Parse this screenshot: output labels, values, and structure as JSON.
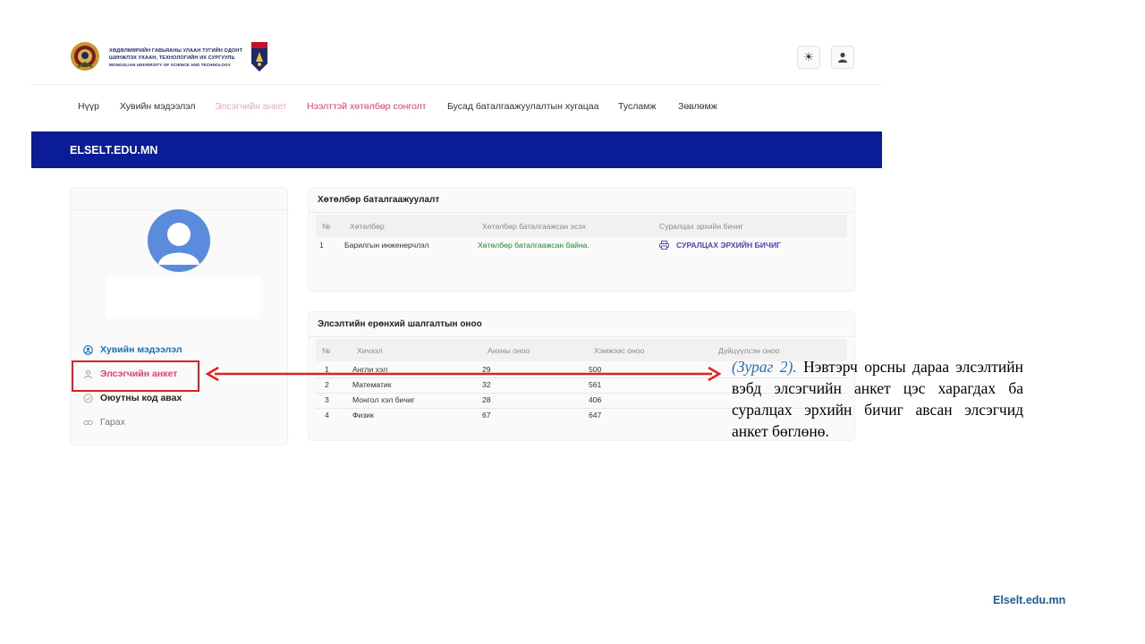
{
  "header": {
    "logo_text": [
      "ХӨДӨЛМӨРИЙН ГАВЬЯАНЫ УЛААН ТУГИЙН ОДОНТ",
      "ШИНЖЛЭХ УХААН, ТЕХНОЛОГИЙН ИХ СУРГУУЛЬ",
      "MONGOLIAN UNIVERSITY OF SCIENCE AND TECHNOLOGY"
    ],
    "theme_icon": "sun-icon",
    "profile_icon": "user-icon"
  },
  "nav": {
    "items": [
      {
        "label": "Нүүр"
      },
      {
        "label": "Хувийн мэдээлэл"
      },
      {
        "label": "Элсэгчийн анкет"
      },
      {
        "label": "Нээлттэй хөтөлбөр сонголт"
      },
      {
        "label": "Бусад баталгаажуулалтын хугацаа"
      },
      {
        "label": "Тусламж"
      },
      {
        "label": "Зөвлөмж"
      }
    ]
  },
  "banner": {
    "title": "ELSELT.EDU.MN"
  },
  "sidebar": {
    "items": [
      {
        "label": "Хувийн мэдээлэл",
        "icon": "user-circle-icon"
      },
      {
        "label": "Элсэгчийн анкет",
        "icon": "user-icon"
      },
      {
        "label": "Оюутны код авах",
        "icon": "check-circle-icon"
      },
      {
        "label": "Гарах",
        "icon": "link-icon"
      }
    ]
  },
  "program_card": {
    "title": "Хөтөлбөр баталгаажуулалт",
    "columns": [
      "№",
      "Хөтөлбөр",
      "Хөтөлбөр баталгаажсан эсэх",
      "Суралцах эрхийн бичиг"
    ],
    "rows": [
      {
        "no": "1",
        "program": "Барилгын инженерчлэл",
        "status": "Хөтөлбөр баталгаажсан байна.",
        "certificate": "СУРАЛЦАХ ЭРХИЙН БИЧИГ"
      }
    ]
  },
  "score_card": {
    "title": "Элсэлтийн ерөнхий шалгалтын оноо",
    "columns": [
      "№",
      "Хичээл",
      "Анхны оноо",
      "Хэмжээс оноо",
      "Дүйцүүлсэн оноо"
    ],
    "rows": [
      {
        "no": "1",
        "subject": "Англи хэл",
        "raw": "29",
        "scaled": "500"
      },
      {
        "no": "2",
        "subject": "Математик",
        "raw": "32",
        "scaled": "561"
      },
      {
        "no": "3",
        "subject": "Монгол хэл бичиг",
        "raw": "28",
        "scaled": "406"
      },
      {
        "no": "4",
        "subject": "Физик",
        "raw": "67",
        "scaled": "647"
      }
    ]
  },
  "annotation": {
    "ref": "(Зураг 2).",
    "text": " Нэвтэрч орсны дараа элсэлтийн вэбд элсэгчийн анкет цэс харагдах ба суралцах эрхийн бичиг авсан элсэгчид анкет бөглөнө.",
    "arrow_color": "#e02020"
  },
  "footer": {
    "site": "Elselt.edu.mn"
  },
  "colors": {
    "banner": "#0b1d96",
    "active_nav": "#e8416b",
    "highlight": "#e02020"
  }
}
